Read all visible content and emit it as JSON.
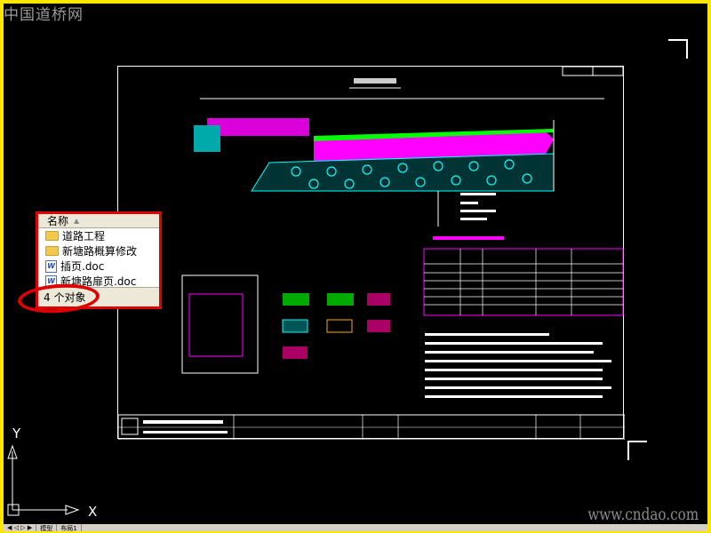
{
  "watermarks": {
    "top": "中国道桥网",
    "bottom": "www.cndao.com"
  },
  "file_panel": {
    "column_header": "名称",
    "items": [
      {
        "name": "道路工程",
        "icon": "folder-icon"
      },
      {
        "name": "新塘路概算修改",
        "icon": "folder-icon"
      },
      {
        "name": "插页.doc",
        "icon": "word-doc-icon"
      },
      {
        "name": "新塘路扉页.doc",
        "icon": "word-doc-icon"
      }
    ],
    "status": "4 个对象"
  },
  "cad": {
    "ucs_x": "X",
    "ucs_y": "Y",
    "tabs": [
      "模型",
      "布局1"
    ]
  },
  "colors": {
    "frame": "#ffe600",
    "highlight": "#e00000",
    "magenta": "#ff00ff",
    "cyan": "#00ffff",
    "green": "#00ff00"
  }
}
